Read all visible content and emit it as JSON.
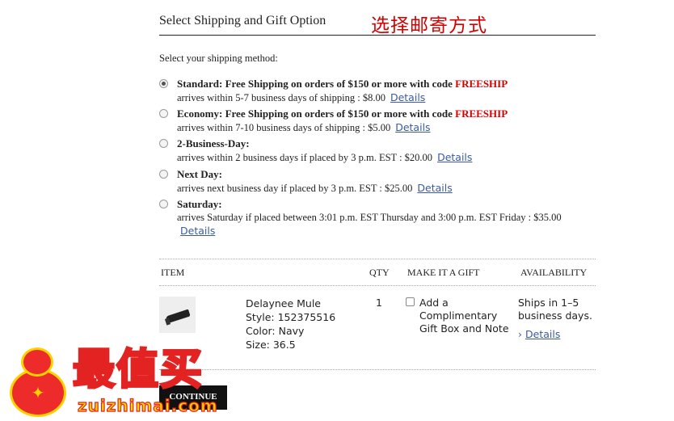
{
  "section": {
    "title": "Select Shipping and Gift Option",
    "chinese_note": "选择邮寄方式"
  },
  "shipping": {
    "prompt": "Select your shipping method:",
    "selected_index": 0,
    "options": [
      {
        "name": "Standard: Free Shipping on orders of $150 or more with code ",
        "code": "FREESHIP",
        "sub": "arrives within 5-7 business days of shipping : $8.00",
        "details": "Details"
      },
      {
        "name": "Economy: Free Shipping on orders of $150 or more with code ",
        "code": "FREESHIP",
        "sub": "arrives within 7-10 business days of shipping : $5.00",
        "details": "Details"
      },
      {
        "name": "2-Business-Day:",
        "code": "",
        "sub": "arrives within 2 business days if placed by 3 p.m. EST : $20.00",
        "details": "Details"
      },
      {
        "name": "Next Day:",
        "code": "",
        "sub": "arrives next business day if placed by 3 p.m. EST : $25.00",
        "details": "Details"
      },
      {
        "name": "Saturday:",
        "code": "",
        "sub": "arrives Saturday if placed between 3:01 p.m. EST Thursday and 3:00 p.m. EST Friday : $35.00",
        "details": "Details"
      }
    ]
  },
  "table": {
    "headers": {
      "item": "ITEM",
      "qty": "QTY",
      "gift": "MAKE IT A GIFT",
      "availability": "AVAILABILITY"
    },
    "row": {
      "name": "Delaynee Mule",
      "style": "Style: 152375516",
      "color": "Color: Navy",
      "size": "Size: 36.5",
      "qty": "1",
      "gift_text": "Add a Complimentary Gift Box and Note",
      "gift_checked": false,
      "availability": "Ships in 1–5 business days.",
      "availability_chevron": "›",
      "details": "Details"
    }
  },
  "continue_label": "CONTINUE",
  "watermark": {
    "brand": "最值买",
    "domain": "zuizhimai.com"
  },
  "colors": {
    "promo_code": "#d40000",
    "link": "#3a5ba0",
    "button": "#111111",
    "watermark_red": "#e32222",
    "watermark_yellow": "#ffd200"
  },
  "icons": {
    "radio": "radio-circle",
    "checkbox": "checkbox-square",
    "chevron": "chevron-right-icon",
    "product_image": "shoe-thumbnail"
  }
}
